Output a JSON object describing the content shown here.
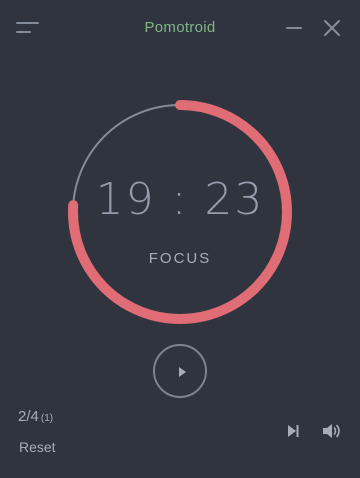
{
  "app": {
    "title": "Pomotroid"
  },
  "timer": {
    "time": "19 : 23",
    "round_type": "FOCUS",
    "progress_remaining": 0.76
  },
  "footer": {
    "round_count": "2/4",
    "round_total": "(1)",
    "reset_label": "Reset"
  },
  "icons": {
    "menu": "menu-icon",
    "minimize": "minimize-icon",
    "close": "close-icon",
    "play": "play-icon",
    "skip": "skip-icon",
    "volume": "volume-icon"
  },
  "colors": {
    "background": "#2f343f",
    "accent_focus": "#e06c75",
    "title": "#81b586",
    "track": "#858c99"
  }
}
